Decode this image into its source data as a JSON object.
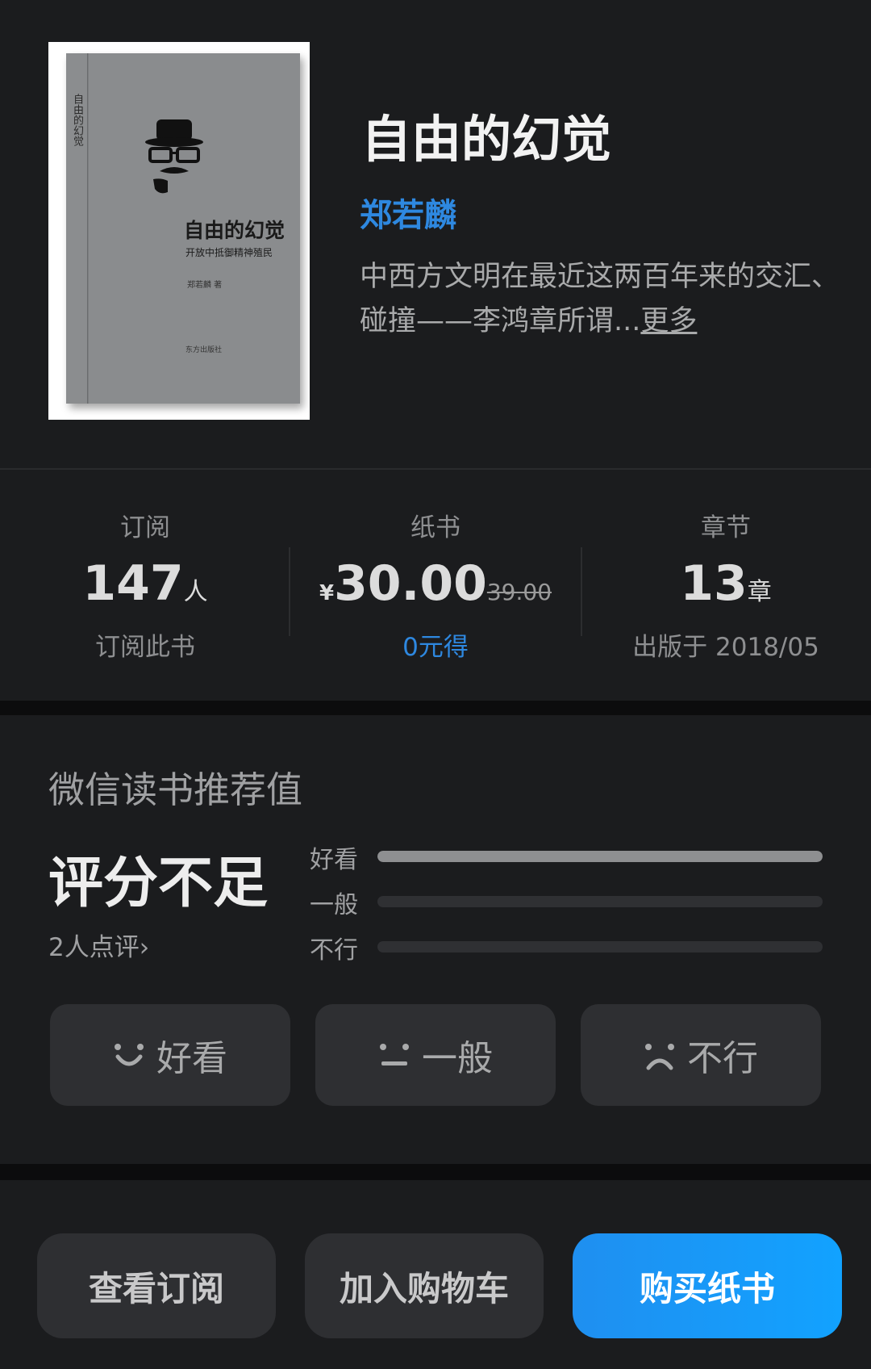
{
  "book": {
    "title": "自由的幻觉",
    "author": "郑若麟",
    "description": "中西方文明在最近这两百年来的交汇、碰撞——李鸿章所谓...",
    "more_label": "更多",
    "cover": {
      "title": "自由的幻觉",
      "subtitle": "开放中抵御精神殖民",
      "author_line": "郑若麟 著",
      "spine_text": "自由的幻觉",
      "publisher": "东方出版社"
    }
  },
  "stats": {
    "subscribe": {
      "label": "订阅",
      "value": "147",
      "unit": "人",
      "note": "订阅此书"
    },
    "paper": {
      "label": "纸书",
      "currency": "¥",
      "price": "30.00",
      "original_price": "39.00",
      "note": "0元得"
    },
    "chapters": {
      "label": "章节",
      "value": "13",
      "unit": "章",
      "note": "出版于 2018/05"
    }
  },
  "rating": {
    "title": "微信读书推荐值",
    "score_text": "评分不足",
    "count_text": "2人点评",
    "bars": [
      {
        "label": "好看",
        "fraction": 1.0
      },
      {
        "label": "一般",
        "fraction": 0.0
      },
      {
        "label": "不行",
        "fraction": 0.0
      }
    ],
    "vote_buttons": [
      {
        "label": "好看",
        "icon": "smile-icon"
      },
      {
        "label": "一般",
        "icon": "neutral-face-icon"
      },
      {
        "label": "不行",
        "icon": "frown-icon"
      }
    ]
  },
  "actions": {
    "view_subscribe": "查看订阅",
    "add_cart": "加入购物车",
    "buy_paper": "购买纸书"
  },
  "colors": {
    "background": "#1b1c1e",
    "accent_blue": "#2e88e0",
    "button_dark": "#2e2f32",
    "buy_button": "#1f8ff0"
  }
}
